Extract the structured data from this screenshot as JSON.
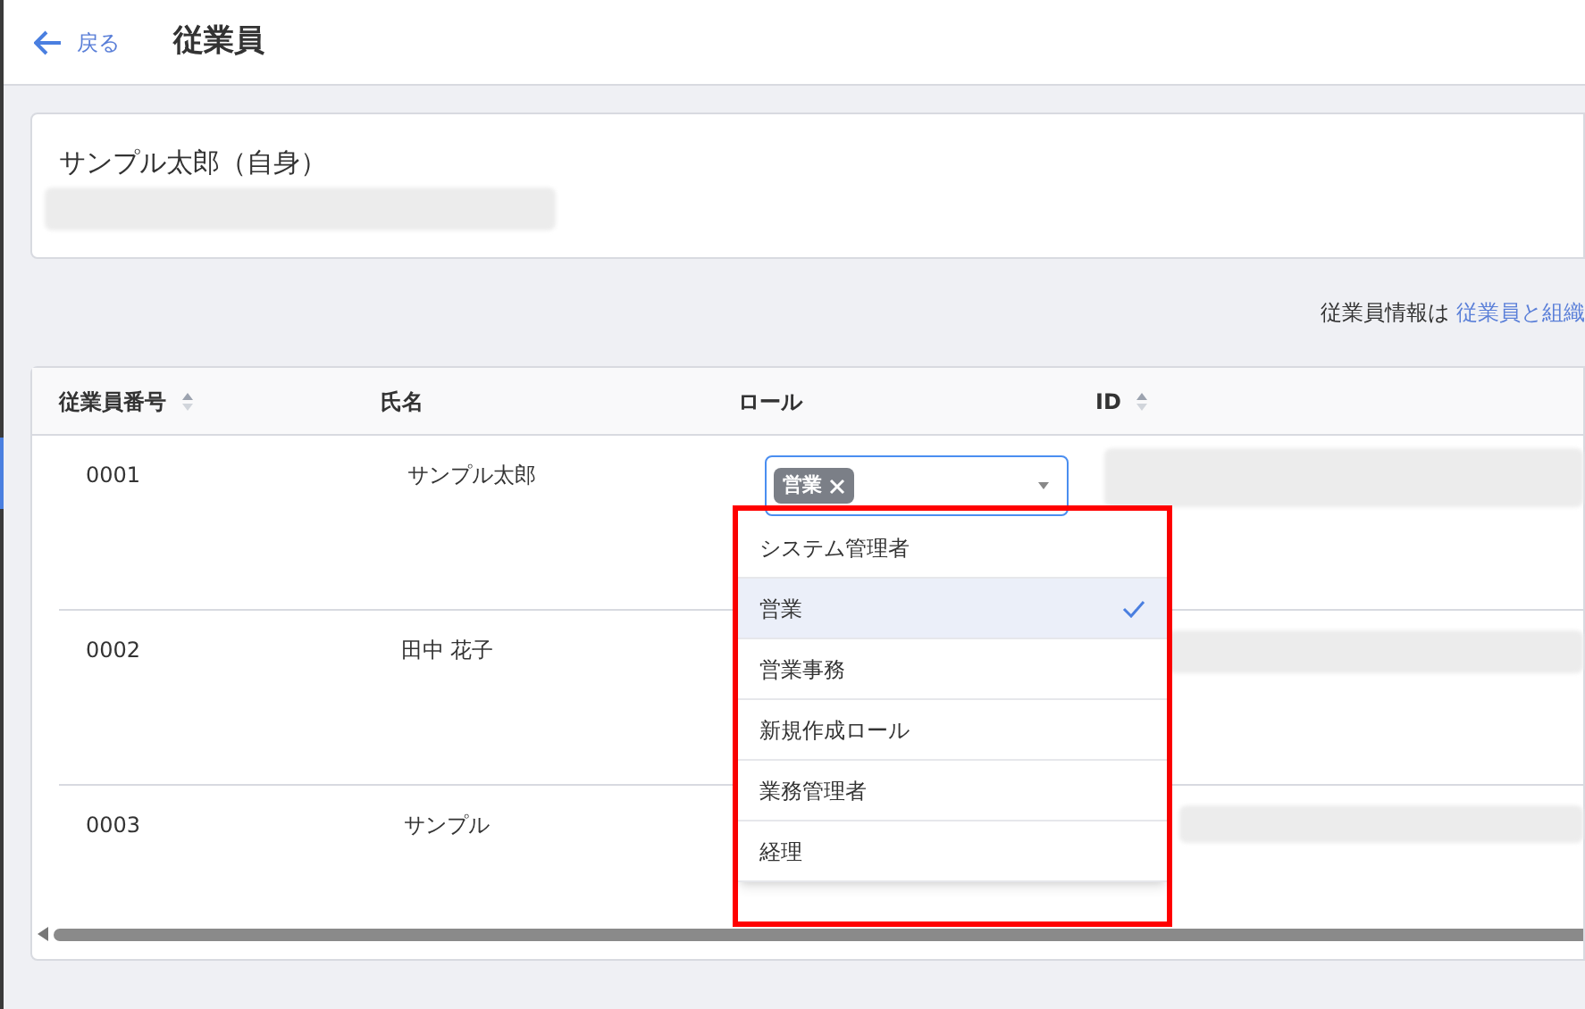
{
  "header": {
    "back": "戻る",
    "title": "従業員"
  },
  "profile": {
    "name": "サンプル太郎（自身）"
  },
  "notice": {
    "text": "従業員情報は",
    "link": "従業員と組織"
  },
  "table": {
    "columns": [
      {
        "label": "従業員番号",
        "sortable": true
      },
      {
        "label": "氏名",
        "sortable": false
      },
      {
        "label": "ロール",
        "sortable": false
      },
      {
        "label": "ID",
        "sortable": true
      }
    ],
    "rows": [
      {
        "number": "0001",
        "name": "サンプル太郎",
        "roles": [
          "営業"
        ]
      },
      {
        "number": "0002",
        "name": "田中 花子",
        "roles": []
      },
      {
        "number": "0003",
        "name": "サンプル",
        "roles": []
      }
    ]
  },
  "role_menu": {
    "options": [
      {
        "label": "システム管理者",
        "selected": false
      },
      {
        "label": "営業",
        "selected": true
      },
      {
        "label": "営業事務",
        "selected": false
      },
      {
        "label": "新規作成ロール",
        "selected": false
      },
      {
        "label": "業務管理者",
        "selected": false
      },
      {
        "label": "経理",
        "selected": false
      }
    ]
  }
}
